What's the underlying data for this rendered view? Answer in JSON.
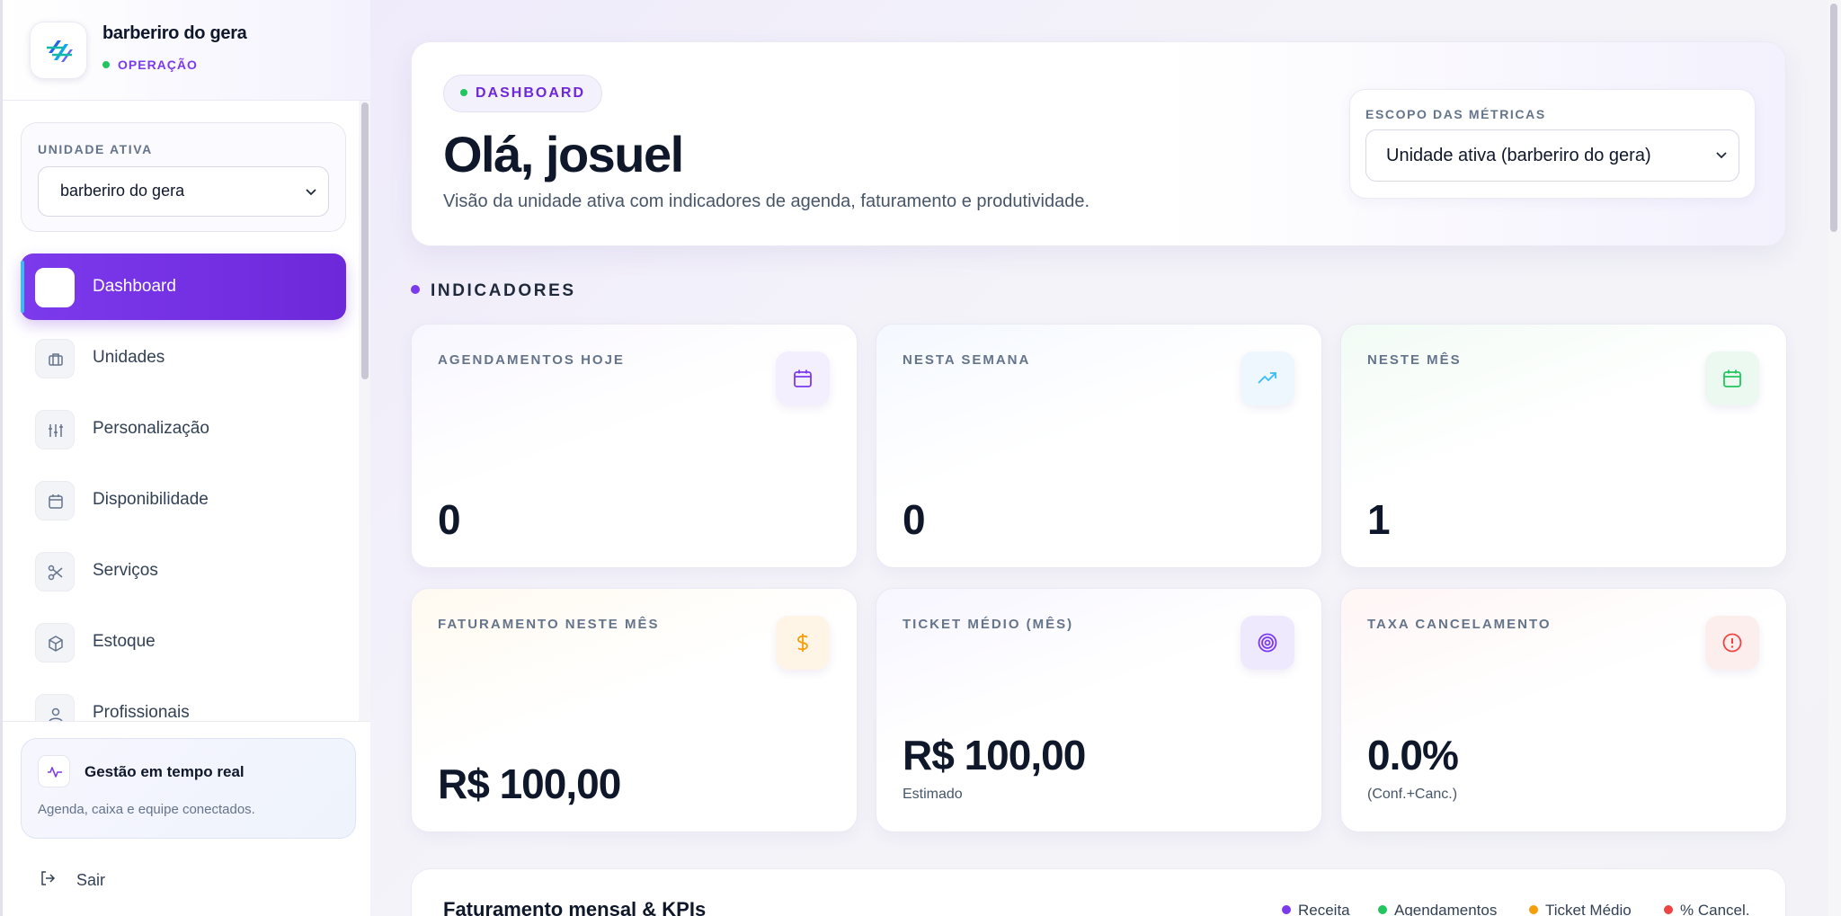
{
  "brand": {
    "name": "barberiro do gera",
    "status": "OPERAÇÃO"
  },
  "unit": {
    "label": "UNIDADE ATIVA",
    "selected": "barberiro do gera"
  },
  "nav": {
    "items": [
      {
        "label": "Dashboard",
        "icon": "grid-icon",
        "active": true
      },
      {
        "label": "Unidades",
        "icon": "briefcase-icon"
      },
      {
        "label": "Personalização",
        "icon": "sliders-icon"
      },
      {
        "label": "Disponibilidade",
        "icon": "calendar-icon"
      },
      {
        "label": "Serviços",
        "icon": "scissors-icon"
      },
      {
        "label": "Estoque",
        "icon": "box-icon"
      },
      {
        "label": "Profissionais",
        "icon": "user-icon"
      }
    ]
  },
  "realtime": {
    "title": "Gestão em tempo real",
    "description": "Agenda, caixa e equipe conectados."
  },
  "logout": {
    "label": "Sair"
  },
  "hero": {
    "pill": "DASHBOARD",
    "greeting": "Olá, josuel",
    "subtitle": "Visão da unidade ativa com indicadores de agenda, faturamento e produtividade."
  },
  "scope": {
    "label": "ESCOPO DAS MÉTRICAS",
    "selected": "Unidade ativa (barberiro do gera)"
  },
  "indicators": {
    "title": "INDICADORES",
    "cards": [
      {
        "label": "AGENDAMENTOS HOJE",
        "value": "0",
        "note": "",
        "icon": "calendar-icon",
        "color": "#7c3aed"
      },
      {
        "label": "NESTA SEMANA",
        "value": "0",
        "note": "",
        "icon": "trending-up-icon",
        "color": "#38bdf8"
      },
      {
        "label": "NESTE MÊS",
        "value": "1",
        "note": "",
        "icon": "calendar-icon",
        "color": "#22c55e"
      },
      {
        "label": "FATURAMENTO NESTE MÊS",
        "value": "R$ 100,00",
        "note": "",
        "icon": "dollar-icon",
        "color": "#f59e0b"
      },
      {
        "label": "TICKET MÉDIO (MÊS)",
        "value": "R$ 100,00",
        "note": "Estimado",
        "icon": "target-icon",
        "color": "#7c3aed"
      },
      {
        "label": "TAXA CANCELAMENTO",
        "value": "0.0%",
        "note": "(Conf.+Canc.)",
        "icon": "alert-circle-icon",
        "color": "#ef4444"
      }
    ]
  },
  "chart": {
    "title": "Faturamento mensal & KPIs",
    "legend": [
      {
        "label": "Receita",
        "color": "#7c3aed"
      },
      {
        "label": "Agendamentos",
        "color": "#22c55e"
      },
      {
        "label": "Ticket Médio",
        "color": "#f59e0b"
      },
      {
        "label": "% Cancel.",
        "color": "#ef4444"
      }
    ]
  },
  "colors": {
    "accent": "#7c3aed",
    "status_green": "#22c55e"
  }
}
